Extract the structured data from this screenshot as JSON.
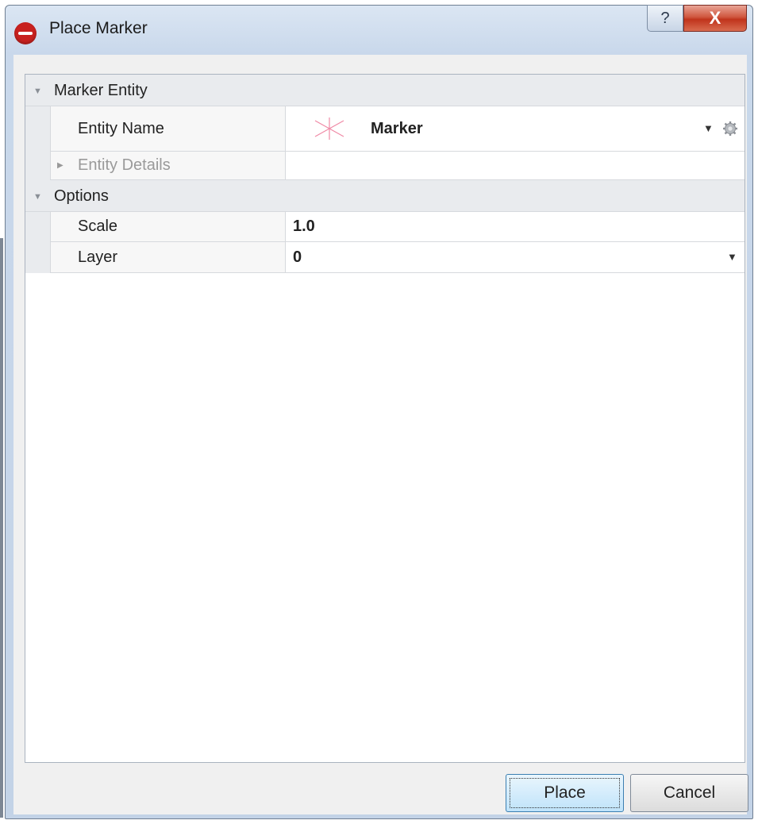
{
  "window": {
    "title": "Place Marker",
    "help_label": "?",
    "close_label": "X"
  },
  "grid": {
    "categories": [
      {
        "label": "Marker Entity",
        "expanded": true
      },
      {
        "label": "Options",
        "expanded": true
      }
    ],
    "entity_name": {
      "label": "Entity Name",
      "value": "Marker"
    },
    "entity_details": {
      "label": "Entity Details"
    },
    "scale": {
      "label": "Scale",
      "value": "1.0"
    },
    "layer": {
      "label": "Layer",
      "value": "0"
    }
  },
  "buttons": {
    "place": "Place",
    "cancel": "Cancel"
  },
  "colors": {
    "accent": "#c8211f",
    "marker_symbol": "#f08aa6"
  },
  "icons": [
    "app-logo-icon",
    "help-icon",
    "close-icon",
    "collapse-triangle-icon",
    "expand-triangle-icon",
    "marker-symbol-icon",
    "dropdown-arrow-icon",
    "settings-gear-icon"
  ]
}
